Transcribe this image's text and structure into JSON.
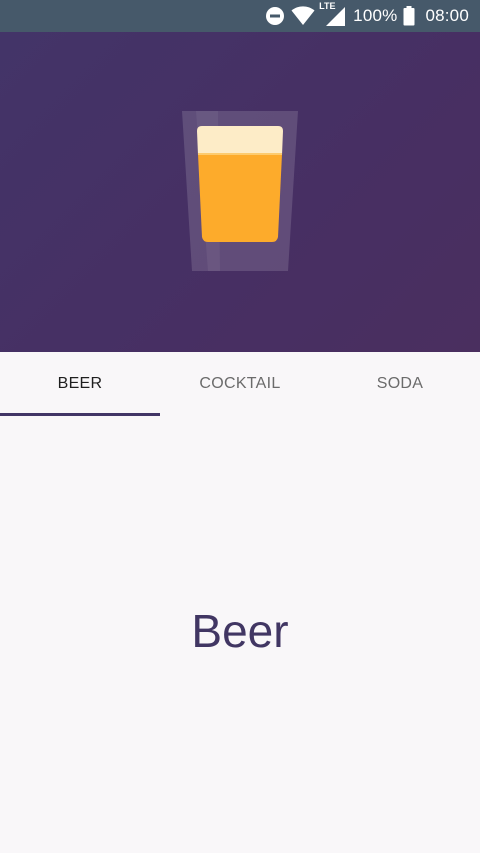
{
  "status_bar": {
    "battery_text": "100%",
    "time": "08:00",
    "network_label": "LTE",
    "icons": [
      "do-not-disturb-icon",
      "wifi-icon",
      "cellular-signal-icon",
      "battery-icon"
    ]
  },
  "hero": {
    "illustration": "beer-glass-icon",
    "background_color": "#453166"
  },
  "tabs": {
    "items": [
      {
        "label": "BEER",
        "active": true
      },
      {
        "label": "COCKTAIL",
        "active": false
      },
      {
        "label": "SODA",
        "active": false
      }
    ],
    "indicator_color": "#423566"
  },
  "content": {
    "title": "Beer"
  }
}
